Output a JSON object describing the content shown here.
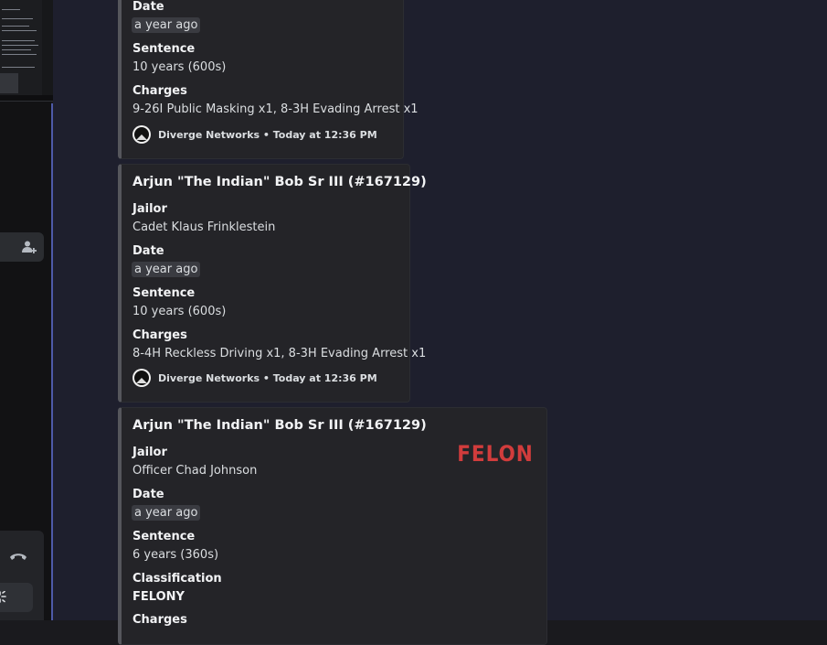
{
  "sidebar": {
    "add_member_icon": "add-user-icon",
    "hangup_icon": "phone-hangup-icon",
    "activity_icon": "loading-spinner-icon"
  },
  "embeds": [
    {
      "fields": [
        {
          "name": "Date",
          "value": "a year ago",
          "timestamp": true
        },
        {
          "name": "Sentence",
          "value": "10 years (600s)"
        },
        {
          "name": "Charges",
          "value": "9-26I Public Masking x1, 8-3H Evading Arrest x1"
        }
      ],
      "footer": "Diverge Networks • Today at 12:36 PM"
    },
    {
      "title": "Arjun \"The Indian\" Bob Sr III (#167129)",
      "fields": [
        {
          "name": "Jailor",
          "value": "Cadet Klaus Frinklestein"
        },
        {
          "name": "Date",
          "value": "a year ago",
          "timestamp": true
        },
        {
          "name": "Sentence",
          "value": "10 years (600s)"
        },
        {
          "name": "Charges",
          "value": "8-4H Reckless Driving x1, 8-3H Evading Arrest x1"
        }
      ],
      "footer": "Diverge Networks • Today at 12:36 PM"
    },
    {
      "title": "Arjun \"The Indian\" Bob Sr III (#167129)",
      "thumbnail_text": "FELON",
      "fields": [
        {
          "name": "Jailor",
          "value": "Officer Chad Johnson"
        },
        {
          "name": "Date",
          "value": "a year ago",
          "timestamp": true
        },
        {
          "name": "Sentence",
          "value": "6 years (360s)"
        },
        {
          "name": "Classification",
          "value": "FELONY"
        },
        {
          "name": "Charges",
          "value": ""
        }
      ]
    }
  ],
  "colors": {
    "background": "#1e1f2d",
    "embed_bg": "#242428",
    "embed_border": "#55565c",
    "felon_red": "#d13c3c",
    "sidebar_accent": "#4e5aa8"
  }
}
